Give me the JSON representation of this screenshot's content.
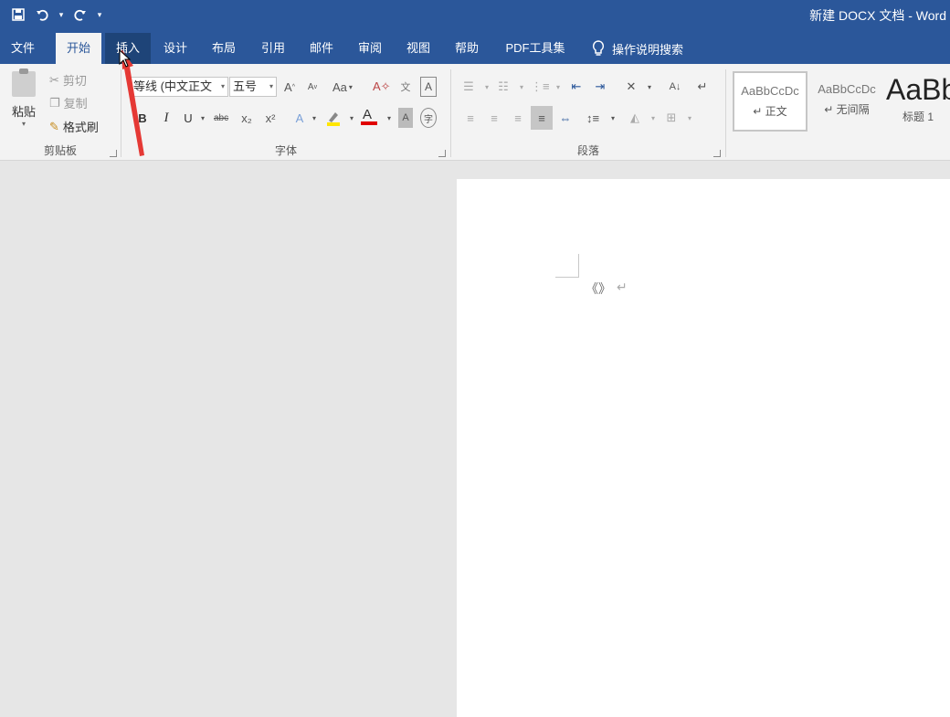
{
  "titlebar": {
    "qat": {
      "save_icon": "save-icon",
      "undo_icon": "undo-icon",
      "redo_icon": "redo-icon",
      "customize_icon": "customize-qat-icon"
    },
    "doc_title": "新建 DOCX 文档 - Word"
  },
  "tabs": [
    "文件",
    "开始",
    "插入",
    "设计",
    "布局",
    "引用",
    "邮件",
    "审阅",
    "视图",
    "帮助",
    "PDF工具集"
  ],
  "tell_me": "操作说明搜索",
  "clipboard": {
    "paste": "粘贴",
    "cut": "剪切",
    "copy": "复制",
    "format_painter": "格式刷",
    "group_label": "剪贴板"
  },
  "font": {
    "font_name": "等线 (中文正文",
    "font_size": "五号",
    "group_label": "字体",
    "change_case": "Aa",
    "bold": "B",
    "italic": "I",
    "underline": "U",
    "strikethrough": "abc",
    "subscript": "x₂",
    "superscript": "x²"
  },
  "paragraph": {
    "group_label": "段落"
  },
  "styles": {
    "items": [
      {
        "sample": "AaBbCcDc",
        "name": "↵ 正文"
      },
      {
        "sample": "AaBbCcDc",
        "name": "↵ 无间隔"
      },
      {
        "sample": "AaBb",
        "name": "标题 1"
      }
    ]
  },
  "document": {
    "caret_glyph": "《》",
    "para_mark": "↵"
  },
  "colors": {
    "brand": "#2b579a",
    "ribbon": "#f3f3f3",
    "arrow": "#e53935",
    "font_color": "#e00000",
    "highlight": "#ffe600"
  }
}
